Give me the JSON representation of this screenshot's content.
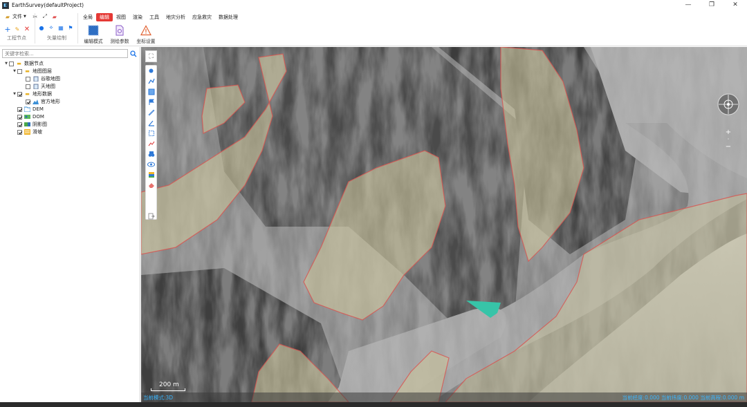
{
  "window": {
    "title": "EarthSurvey(defaultProject)",
    "controls": [
      "—",
      "❐",
      "✕"
    ]
  },
  "toolbar": {
    "file_label": "文件",
    "project_group_label": "工程节点",
    "vector_group_label": "矢量绘制",
    "menu": [
      "全局",
      "编辑",
      "视图",
      "渲染",
      "工具",
      "地灾分析",
      "应急救灾",
      "数据处理"
    ],
    "active_menu_index": 1,
    "big_buttons": [
      {
        "label": "编辑模式",
        "icon": "edit-mode-icon"
      },
      {
        "label": "测绘参数",
        "icon": "settings-doc-icon"
      },
      {
        "label": "坐标设置",
        "icon": "warning-triangle-icon"
      }
    ],
    "accent": "#e53935"
  },
  "left_panel": {
    "search_placeholder": "关键字检索...",
    "tree": [
      {
        "label": "数据节点",
        "level": 0,
        "expanded": true,
        "checked": false,
        "icon": "folder-icon"
      },
      {
        "label": "地图图层",
        "level": 1,
        "expanded": true,
        "checked": false,
        "icon": "folder-icon"
      },
      {
        "label": "谷歌地图",
        "level": 2,
        "checked": false,
        "icon": "map-layer-icon"
      },
      {
        "label": "天地图",
        "level": 2,
        "checked": false,
        "icon": "map-layer-icon"
      },
      {
        "label": "地形数据",
        "level": 1,
        "expanded": true,
        "checked": true,
        "icon": "folder-icon"
      },
      {
        "label": "官方地形",
        "level": 2,
        "checked": true,
        "icon": "terrain-icon"
      },
      {
        "label": "DEM",
        "level": 1,
        "checked": true,
        "icon": "dem-folder-icon"
      },
      {
        "label": "DOM",
        "level": 1,
        "checked": true,
        "icon": "dom-layer-icon"
      },
      {
        "label": "阴影图",
        "level": 1,
        "checked": true,
        "icon": "shadow-layer-icon"
      },
      {
        "label": "滑坡",
        "level": 1,
        "checked": true,
        "icon": "landslide-layer-icon"
      }
    ]
  },
  "map": {
    "scale_label": "200 m",
    "status_left": "当前模式:3D",
    "status_right": "当前经度:0.000 当前纬度:0.000 当前高程:0.000 m",
    "tools": [
      "point-icon",
      "polyline-icon",
      "polygon-icon",
      "flag-icon",
      "ruler-icon",
      "angle-icon",
      "area-icon",
      "profile-icon",
      "binoculars-icon",
      "eye-icon",
      "layers-icon",
      "eraser-icon",
      "exit-icon"
    ],
    "zoom_in": "+",
    "zoom_out": "−"
  }
}
